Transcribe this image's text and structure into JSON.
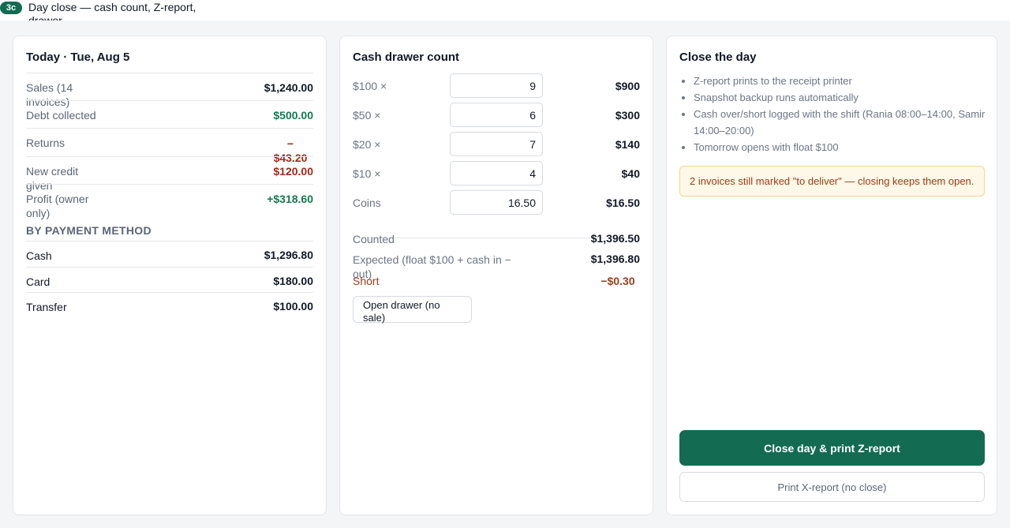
{
  "header": {
    "step": "3c",
    "title": "Day close — cash count, Z-report, drawer"
  },
  "summary": {
    "title": "Today · Tue, Aug 5",
    "rows": [
      {
        "label": "Sales (14 invoices)",
        "value": "$1,240.00"
      },
      {
        "label": "Debt collected",
        "value": "$500.00"
      },
      {
        "label": "Returns",
        "value": "−$43.20"
      },
      {
        "label": "New credit given",
        "value": "$120.00"
      },
      {
        "label": "Profit (owner only)",
        "value": "+$318.60"
      }
    ],
    "payment_heading": "BY PAYMENT METHOD",
    "payments": [
      {
        "label": "Cash",
        "value": "$1,296.80"
      },
      {
        "label": "Card",
        "value": "$180.00"
      },
      {
        "label": "Transfer",
        "value": "$100.00"
      }
    ]
  },
  "drawer": {
    "title": "Cash drawer count",
    "denominations": [
      {
        "label": "$100 ×",
        "count": "9",
        "amount": "$900"
      },
      {
        "label": "$50 ×",
        "count": "6",
        "amount": "$300"
      },
      {
        "label": "$20 ×",
        "count": "7",
        "amount": "$140"
      },
      {
        "label": "$10 ×",
        "count": "4",
        "amount": "$40"
      },
      {
        "label": "Coins",
        "count": "16.50",
        "amount": "$16.50"
      }
    ],
    "counted_label": "Counted",
    "counted_value": "$1,396.50",
    "expected_label": "Expected (float $100 + cash in − out)",
    "expected_value": "$1,396.80",
    "short_label": "Short",
    "short_value": "−$0.30",
    "open_drawer_label": "Open drawer (no sale)"
  },
  "close": {
    "title": "Close the day",
    "notes": [
      "Z-report prints to the receipt printer",
      "Snapshot backup runs automatically",
      "Cash over/short logged with the shift (Rania 08:00–14:00, Samir 14:00–20:00)",
      "Tomorrow opens with float $100"
    ],
    "warning": "2 invoices still marked \"to deliver\" — closing keeps them open.",
    "primary_label": "Close day & print Z-report",
    "secondary_label": "Print X-report (no close)"
  },
  "colors": {
    "brand": "#136b52",
    "positive": "#137a4f",
    "negative": "#a3281b",
    "short": "#98401a",
    "warning_bg": "#fef8e8"
  }
}
